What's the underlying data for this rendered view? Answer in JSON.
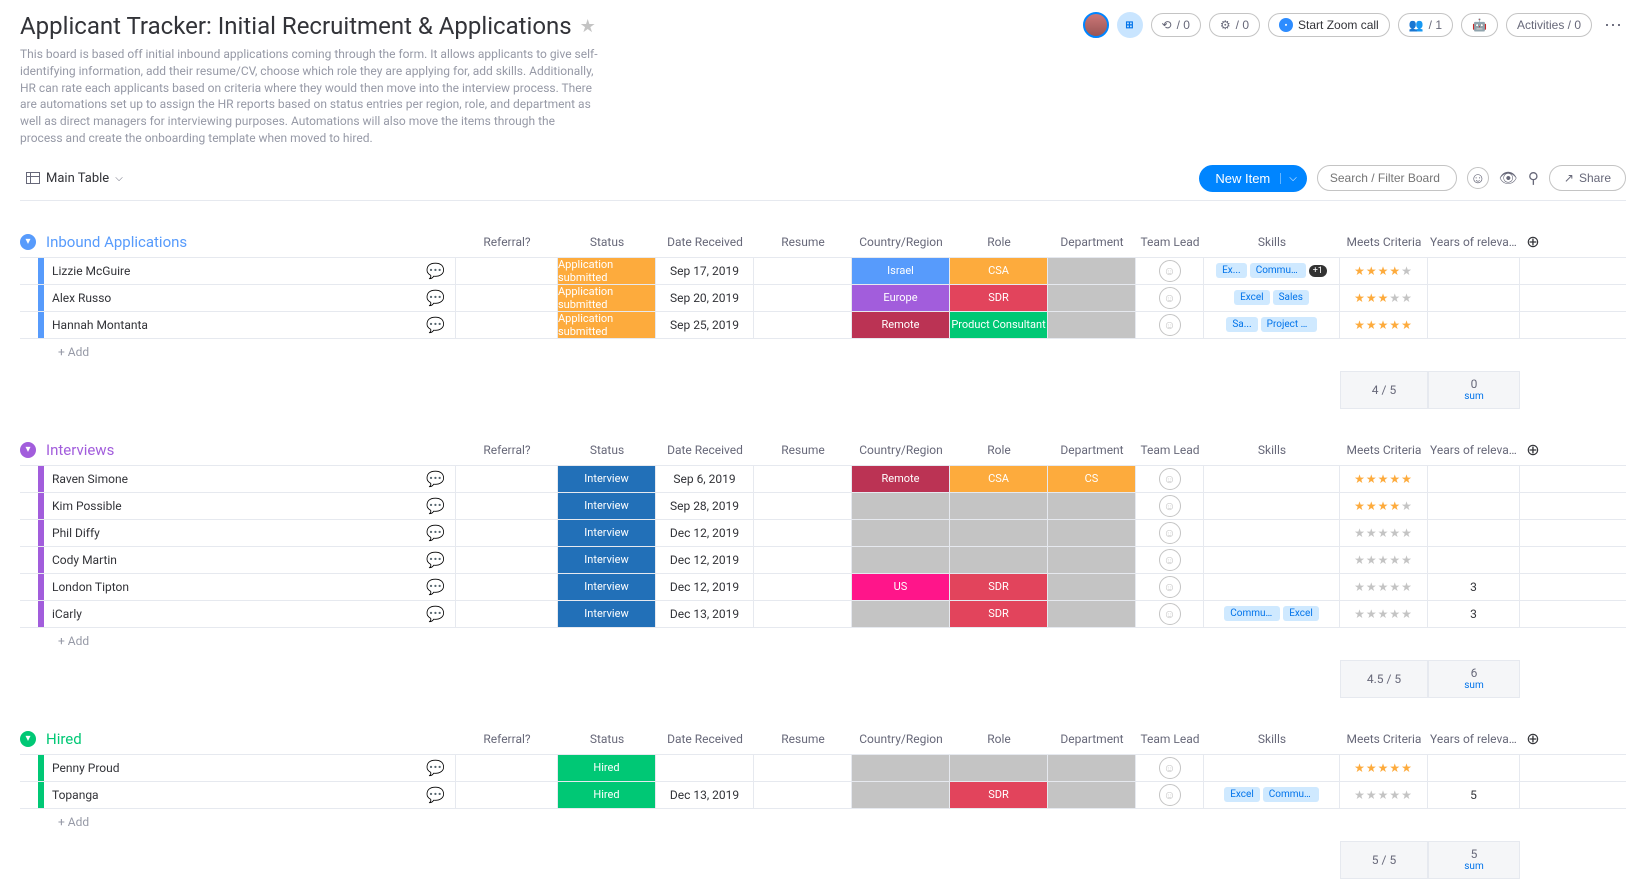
{
  "header": {
    "title": "Applicant Tracker: Initial Recruitment & Applications",
    "description": "This board is based off initial inbound applications coming through the form. It allows applicants to give self-identifying information, add their resume/CV, choose which role they are applying for, add skills. Additionally, HR can rate each applicants based on criteria where they would then move into the interview process. There are automations set up to assign the HR reports based on status entries per region, role, and department as well as direct managers for interviewing purposes. Automations will also move the items through the process and create the onboarding template when moved to hired.",
    "actions": {
      "zoom": "Start Zoom call",
      "members": "/ 1",
      "activities": "Activities / 0",
      "pill1": "/ 0",
      "pill2": "/ 0"
    }
  },
  "toolbar": {
    "view_label": "Main Table",
    "new_item": "New Item",
    "search_placeholder": "Search / Filter Board",
    "share": "Share"
  },
  "columns": [
    "Referral?",
    "Status",
    "Date Received",
    "Resume",
    "Country/Region",
    "Role",
    "Department",
    "Team Lead",
    "Skills",
    "Meets Criteria",
    "Years of relevant w..."
  ],
  "groups": [
    {
      "id": "inbound",
      "title": "Inbound Applications",
      "color": "#579bfc",
      "rows": [
        {
          "name": "Lizzie McGuire",
          "status": {
            "label": "Application submitted",
            "color": "#fdab3d"
          },
          "date": "Sep 17, 2019",
          "country": {
            "label": "Israel",
            "color": "#579bfc"
          },
          "role": {
            "label": "CSA",
            "color": "#fdab3d"
          },
          "dept": null,
          "skills": [
            "Ex...",
            "Communica..."
          ],
          "skills_more": "+1",
          "stars": 4,
          "years": ""
        },
        {
          "name": "Alex Russo",
          "status": {
            "label": "Application submitted",
            "color": "#fdab3d"
          },
          "date": "Sep 20, 2019",
          "country": {
            "label": "Europe",
            "color": "#a25ddc"
          },
          "role": {
            "label": "SDR",
            "color": "#e2445c"
          },
          "dept": null,
          "skills": [
            "Excel",
            "Sales"
          ],
          "stars": 3,
          "years": ""
        },
        {
          "name": "Hannah Montanta",
          "status": {
            "label": "Application submitted",
            "color": "#fdab3d"
          },
          "date": "Sep 25, 2019",
          "country": {
            "label": "Remote",
            "color": "#bb3354"
          },
          "role": {
            "label": "Product Consultant",
            "color": "#00c875"
          },
          "dept": null,
          "skills": [
            "Sa...",
            "Project Manage..."
          ],
          "stars": 5,
          "years": ""
        }
      ],
      "add_label": "+ Add",
      "footer": {
        "criteria": "4 / 5",
        "years": "0",
        "years_sub": "sum"
      }
    },
    {
      "id": "interviews",
      "title": "Interviews",
      "color": "#a25ddc",
      "rows": [
        {
          "name": "Raven Simone",
          "status": {
            "label": "Interview",
            "color": "#2270b8"
          },
          "date": "Sep 6, 2019",
          "country": {
            "label": "Remote",
            "color": "#bb3354"
          },
          "role": {
            "label": "CSA",
            "color": "#fdab3d"
          },
          "dept": {
            "label": "CS",
            "color": "#fdab3d"
          },
          "skills": [],
          "stars": 5,
          "years": ""
        },
        {
          "name": "Kim Possible",
          "status": {
            "label": "Interview",
            "color": "#2270b8"
          },
          "date": "Sep 28, 2019",
          "country": null,
          "role": null,
          "dept": null,
          "skills": [],
          "stars": 4,
          "years": ""
        },
        {
          "name": "Phil Diffy",
          "status": {
            "label": "Interview",
            "color": "#2270b8"
          },
          "date": "Dec 12, 2019",
          "country": null,
          "role": null,
          "dept": null,
          "skills": [],
          "stars": 0,
          "years": ""
        },
        {
          "name": "Cody Martin",
          "status": {
            "label": "Interview",
            "color": "#2270b8"
          },
          "date": "Dec 12, 2019",
          "country": null,
          "role": null,
          "dept": null,
          "skills": [],
          "stars": 0,
          "years": ""
        },
        {
          "name": "London Tipton",
          "status": {
            "label": "Interview",
            "color": "#2270b8"
          },
          "date": "Dec 12, 2019",
          "country": {
            "label": "US",
            "color": "#ff158a"
          },
          "role": {
            "label": "SDR",
            "color": "#e2445c"
          },
          "dept": null,
          "skills": [],
          "stars": 0,
          "years": "3"
        },
        {
          "name": "iCarly",
          "status": {
            "label": "Interview",
            "color": "#2270b8"
          },
          "date": "Dec 13, 2019",
          "country": null,
          "role": {
            "label": "SDR",
            "color": "#e2445c"
          },
          "dept": null,
          "skills": [
            "Communication",
            "Excel"
          ],
          "stars": 0,
          "years": "3"
        }
      ],
      "add_label": "+ Add",
      "footer": {
        "criteria": "4.5 / 5",
        "years": "6",
        "years_sub": "sum"
      }
    },
    {
      "id": "hired",
      "title": "Hired",
      "color": "#00c875",
      "rows": [
        {
          "name": "Penny Proud",
          "status": {
            "label": "Hired",
            "color": "#00c875"
          },
          "date": "",
          "country": null,
          "role": null,
          "dept": null,
          "skills": [],
          "stars": 5,
          "years": ""
        },
        {
          "name": "Topanga",
          "status": {
            "label": "Hired",
            "color": "#00c875"
          },
          "date": "Dec 13, 2019",
          "country": null,
          "role": {
            "label": "SDR",
            "color": "#e2445c"
          },
          "dept": null,
          "skills": [
            "Excel",
            "Communication"
          ],
          "stars": 0,
          "years": "5"
        }
      ],
      "add_label": "+ Add",
      "footer": {
        "criteria": "5 / 5",
        "years": "5",
        "years_sub": "sum"
      }
    }
  ]
}
